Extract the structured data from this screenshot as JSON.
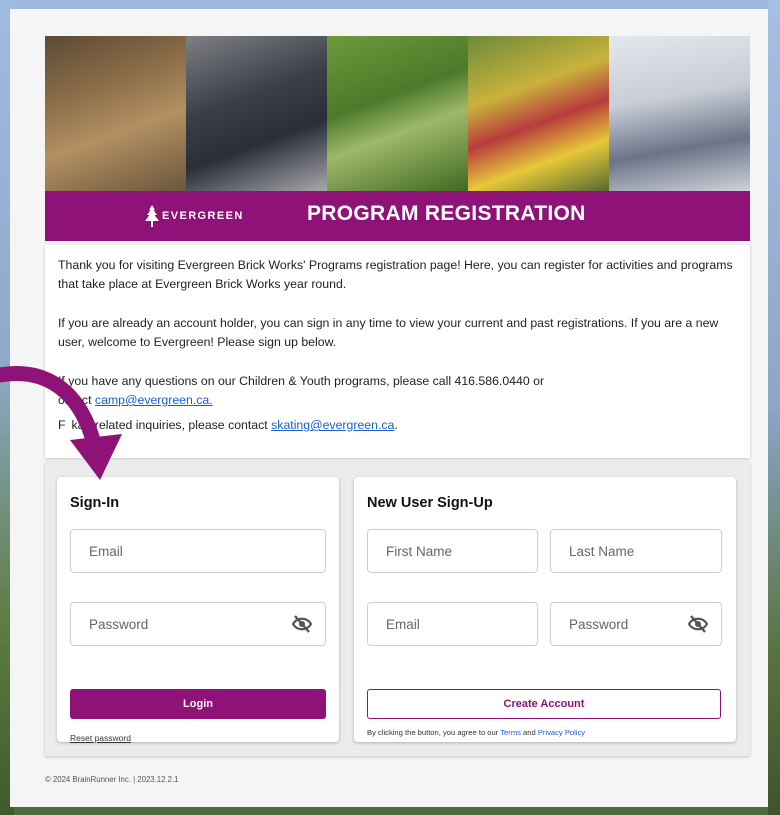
{
  "brand": {
    "logo_text": "EVERGREEN",
    "title": "PROGRAM REGISTRATION",
    "color": "#8f1278"
  },
  "intro": {
    "p1": "Thank you for visiting Evergreen Brick Works' Programs registration page! Here, you can register for activities and programs that take place at Evergreen Brick Works year round.",
    "p2": "If you are already an account holder, you can sign in any time to view your current and past registrations. If you are a new user, welcome to Evergreen! Please sign up below.",
    "p3_text": "If you have any questions on our Children & Youth programs, please call 416.586.0440 or",
    "p3_cont": "ontact ",
    "p3_link": "camp@evergreen.ca.",
    "p4_prefix": "F",
    "p4_mid": "ka",
    "p4_text": "g related inquiries, please contact ",
    "p4_link": "skating@evergreen.ca",
    "p4_suffix": "."
  },
  "signin": {
    "title": "Sign-In",
    "email_placeholder": "Email",
    "password_placeholder": "Password",
    "login_label": "Login",
    "reset_label": "Reset password"
  },
  "signup": {
    "title": "New User Sign-Up",
    "first_name_placeholder": "First Name",
    "last_name_placeholder": "Last Name",
    "email_placeholder": "Email",
    "password_placeholder": "Password",
    "create_label": "Create Account",
    "terms_prefix": "By clicking the button, you agree to our ",
    "terms_link": "Terms",
    "terms_and": " and ",
    "privacy_link": "Privacy Policy"
  },
  "footer": {
    "text": "© 2024 BrainRunner Inc. | 2023.12.2.1"
  },
  "icons": {
    "eye_off": "eye-off-icon",
    "arrow": "curved-arrow-icon",
    "logo": "tree-logo-icon"
  }
}
